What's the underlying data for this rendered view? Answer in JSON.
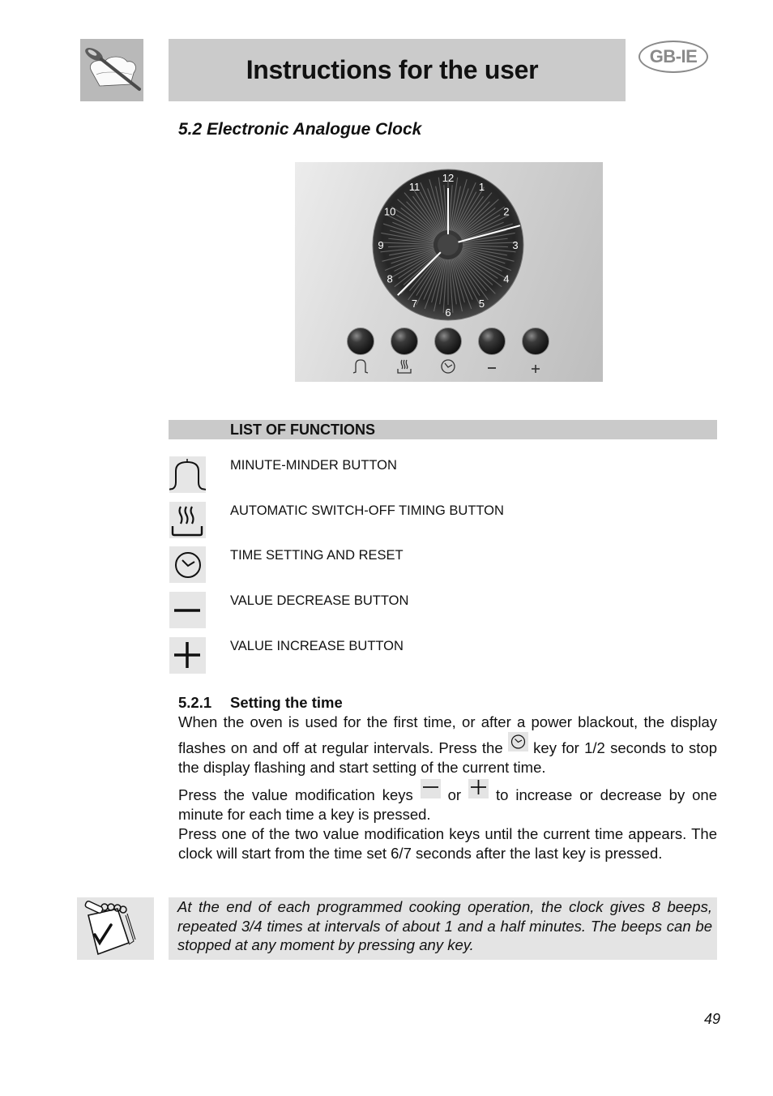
{
  "header": {
    "title": "Instructions for the user",
    "region_badge": "GB-IE",
    "logo_icon": "chef-hat-spoon-icon"
  },
  "section": {
    "title": "5.2 Electronic Analogue Clock"
  },
  "clock_illustration": {
    "dial_numbers": [
      "12",
      "1",
      "2",
      "3",
      "4",
      "5",
      "6",
      "7",
      "8",
      "9",
      "10",
      "11"
    ],
    "hands_pointing_at_hour_marks": [
      12,
      2.5,
      7.5
    ],
    "buttons": [
      {
        "icon": "bell-icon",
        "symbol": "minute-minder"
      },
      {
        "icon": "heat-pan-icon",
        "symbol": "auto-switch-off"
      },
      {
        "icon": "clock-icon",
        "symbol": "time-setting"
      },
      {
        "icon": "minus-icon",
        "symbol": "−"
      },
      {
        "icon": "plus-icon",
        "symbol": "+"
      }
    ]
  },
  "functions": {
    "header": "LIST OF FUNCTIONS",
    "items": [
      {
        "icon": "bell-icon",
        "label": "MINUTE-MINDER BUTTON"
      },
      {
        "icon": "heat-pan-icon",
        "label": "AUTOMATIC SWITCH-OFF TIMING BUTTON"
      },
      {
        "icon": "clock-icon",
        "label": "TIME SETTING AND RESET"
      },
      {
        "icon": "minus-icon",
        "label": "VALUE DECREASE BUTTON"
      },
      {
        "icon": "plus-icon",
        "label": "VALUE INCREASE BUTTON"
      }
    ]
  },
  "setting_time": {
    "number": "5.2.1",
    "heading": "Setting the time",
    "p1_a": "When the oven is used for the first time, or after a power blackout, the display flashes on and off at regular intervals.  Press the ",
    "p1_b": " key for 1/2 seconds to stop the display flashing and start setting of the current time.",
    "p2_a": "Press the value modification keys ",
    "p2_or": " or ",
    "p2_b": " to increase or decrease by one minute for each time a key is pressed.",
    "p3": "Press one of the two value modification keys until the current time appears. The clock will start from the time set 6/7 seconds after the last key is pressed."
  },
  "note": {
    "icon": "notepad-check-icon",
    "text": "At the end of each programmed cooking operation, the clock gives 8 beeps, repeated 3/4 times at intervals of about 1 and a half minutes. The beeps can be stopped at any moment by pressing any key."
  },
  "page_number": "49"
}
